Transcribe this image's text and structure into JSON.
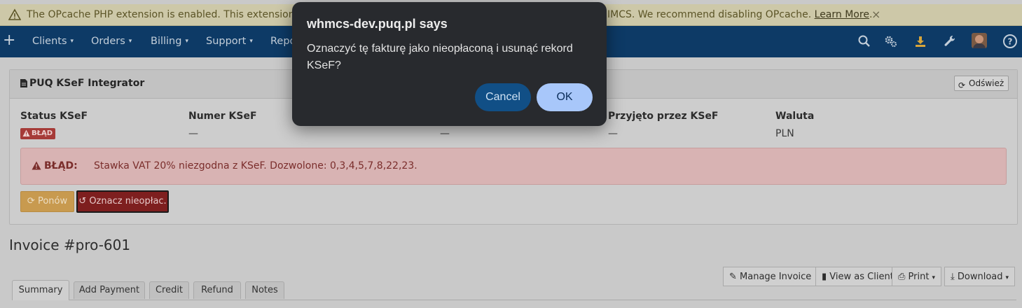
{
  "warning": {
    "text_left": "The OPcache PHP extension is enabled. This extension can",
    "text_right": "IMCS. We recommend disabling OPcache.",
    "learn_more": "Learn More",
    "after_link": ".",
    "close": "×"
  },
  "nav": {
    "plus": "+",
    "items": [
      {
        "label": "Clients"
      },
      {
        "label": "Orders"
      },
      {
        "label": "Billing"
      },
      {
        "label": "Support"
      },
      {
        "label": "Repo"
      }
    ],
    "caret": "▾"
  },
  "panel": {
    "title": "PUQ KSeF Integrator",
    "refresh": "Odśwież",
    "columns": [
      {
        "label": "Status KSeF",
        "value": ""
      },
      {
        "label": "Numer KSeF",
        "value": "—"
      },
      {
        "label": "",
        "value": "—"
      },
      {
        "label": "Przyjęto przez KSeF",
        "value": "—"
      },
      {
        "label": "Waluta",
        "value": "PLN"
      }
    ],
    "status_badge": "BŁĄD",
    "alert_title": "BŁĄD:",
    "alert_message": "Stawka VAT 20% niezgodna z KSeF. Dozwolone: 0,3,4,5,7,8,22,23.",
    "retry_button": "Ponów",
    "mark_unpaid_button": "Oznacz nieopłac."
  },
  "invoice": {
    "title": "Invoice #pro-601",
    "tabs": [
      "Summary",
      "Add Payment",
      "Credit",
      "Refund",
      "Notes"
    ],
    "actions": {
      "manage": "Manage Invoice",
      "view_as_client": "View as Client",
      "print": "Print",
      "download": "Download"
    }
  },
  "dialog": {
    "title": "whmcs-dev.puq.pl says",
    "message": "Oznaczyć tę fakturę jako nieopłaconą i usunąć rekord KSeF?",
    "cancel": "Cancel",
    "ok": "OK"
  },
  "colors": {
    "navbar": "#0d3a66",
    "dialog_bg": "#282a2e",
    "ok_button": "#a8c7fa",
    "cancel_button": "#114f86",
    "error": "#a63b38"
  },
  "icons": [
    "warning-icon",
    "close-icon",
    "plus-icon",
    "search-icon",
    "gears-icon",
    "download-icon",
    "wrench-icon",
    "avatar",
    "help-icon",
    "document-icon",
    "refresh-icon",
    "alert-triangle-icon",
    "undo-icon",
    "edit-icon",
    "file-icon",
    "print-icon"
  ]
}
